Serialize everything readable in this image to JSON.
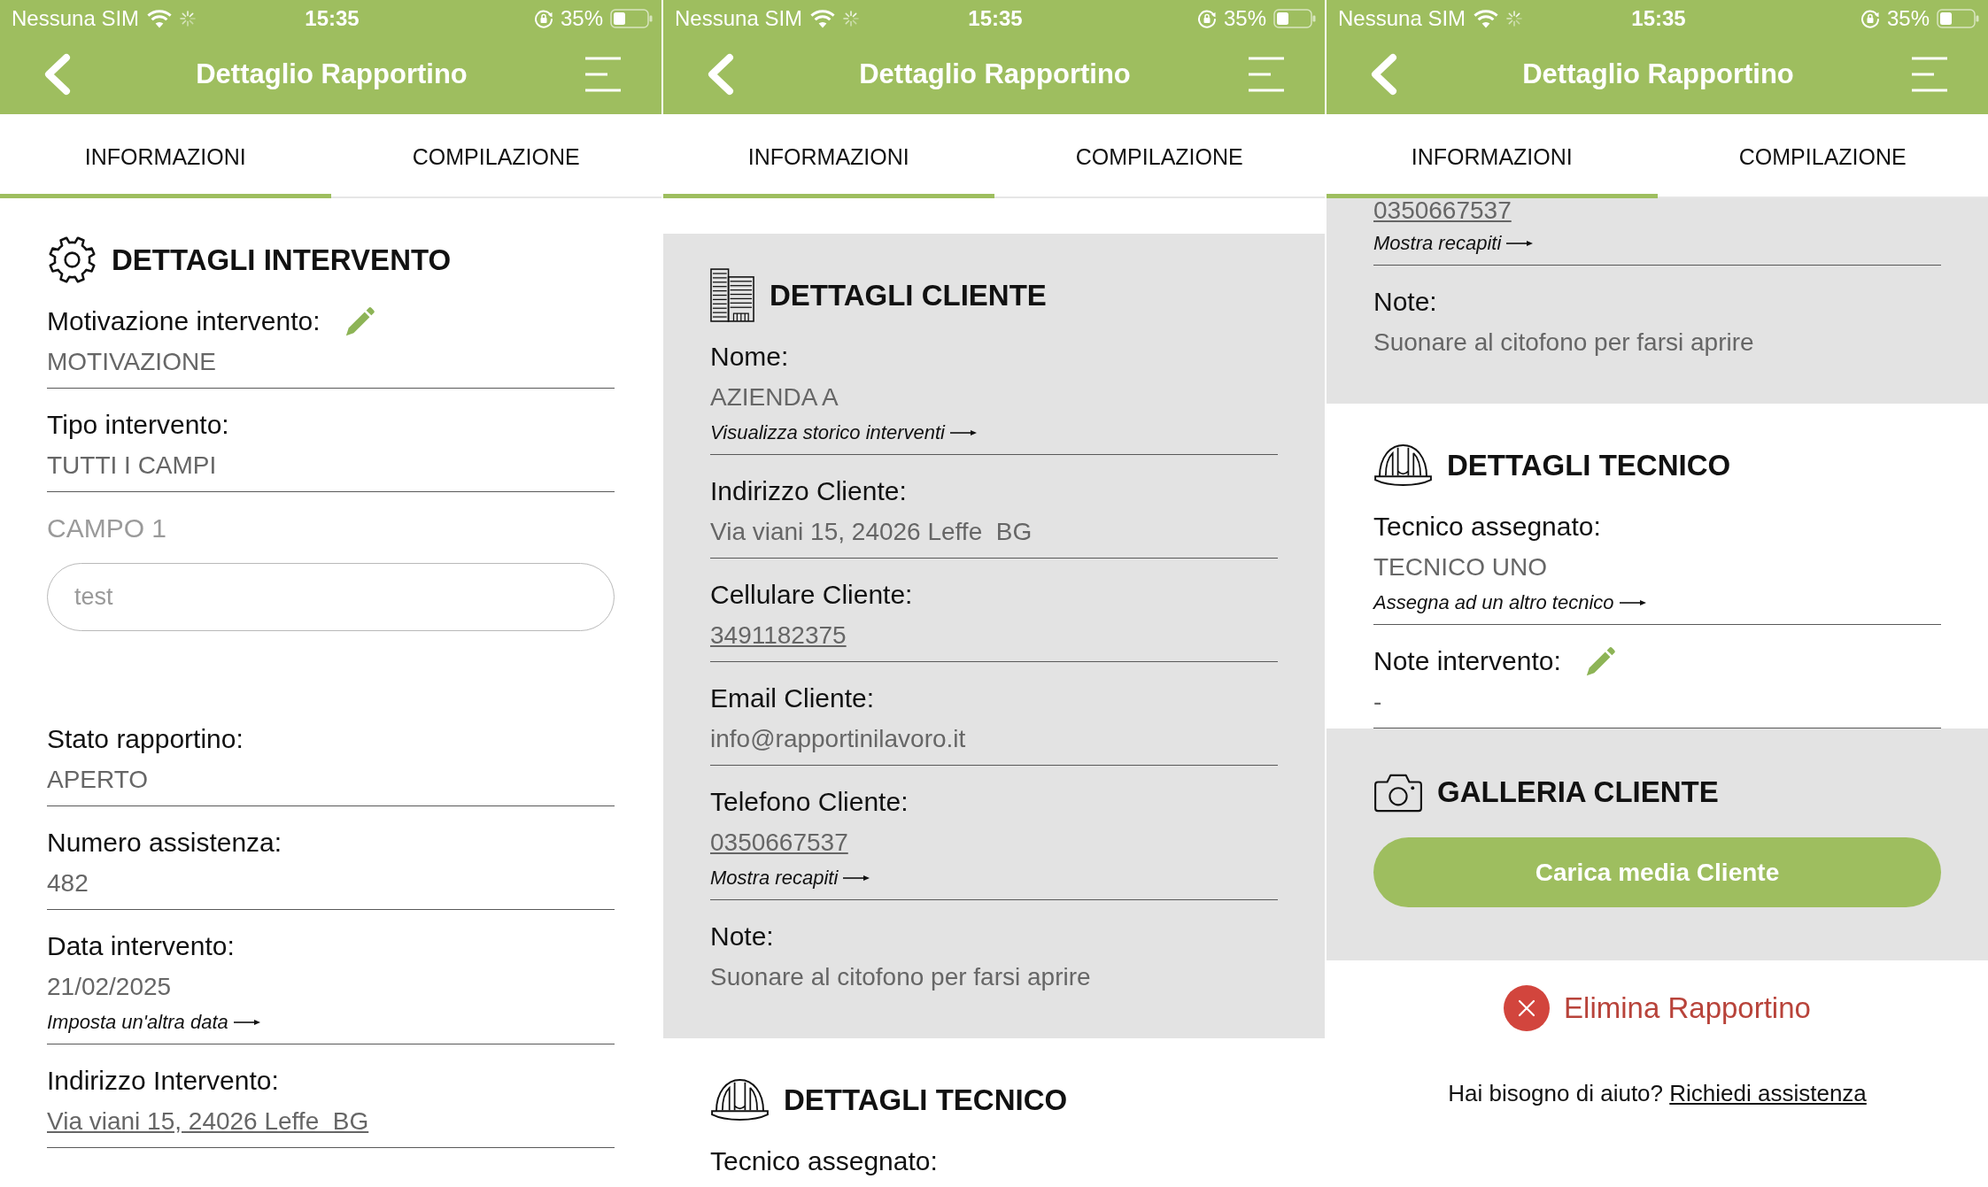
{
  "screens": [
    {
      "status_bar": {
        "carrier": "Nessuna SIM",
        "time": "15:35",
        "battery": "35%"
      },
      "header": {
        "title": "Dettaglio Rapportino"
      },
      "tabs": [
        {
          "label": "INFORMAZIONI",
          "selected": true
        },
        {
          "label": "COMPILAZIONE",
          "selected": false
        }
      ],
      "sections": [
        {
          "kind": "job",
          "shaded": false,
          "title": "DETTAGLI INTERVENTO",
          "fields": [
            {
              "kind": "text",
              "label": "Motivazione intervento:",
              "value": "MOTIVAZIONE",
              "editable": true
            },
            {
              "kind": "text",
              "label": "Tipo intervento:",
              "value": "TUTTI I CAMPI",
              "editable": false
            },
            {
              "kind": "input",
              "label": "CAMPO 1",
              "value": "test",
              "editable": false,
              "disabled": true
            },
            {
              "kind": "text",
              "label": "Stato rapportino:",
              "value": "APERTO",
              "editable": false
            },
            {
              "kind": "text",
              "label": "Numero assistenza:",
              "value": "482",
              "editable": false
            },
            {
              "kind": "text",
              "label": "Data intervento:",
              "value": "21/02/2025",
              "action": "Imposta un'altra data",
              "editable": false
            },
            {
              "kind": "link",
              "label": "Indirizzo Intervento:",
              "value": "Via viani 15, 24026 Leffe  BG",
              "editable": false
            }
          ]
        }
      ]
    },
    {
      "status_bar": {
        "carrier": "Nessuna SIM",
        "time": "15:35",
        "battery": "35%"
      },
      "header": {
        "title": "Dettaglio Rapportino"
      },
      "tabs": [
        {
          "label": "INFORMAZIONI",
          "selected": true
        },
        {
          "label": "COMPILAZIONE",
          "selected": false
        }
      ],
      "sections": [
        {
          "kind": "client",
          "shaded": true,
          "title": "DETTAGLI CLIENTE",
          "fields": [
            {
              "kind": "text",
              "label": "Nome:",
              "value": "AZIENDA A",
              "action": "Visualizza storico interventi",
              "editable": false
            },
            {
              "kind": "text",
              "label": "Indirizzo Cliente:",
              "value": "Via viani 15, 24026 Leffe  BG",
              "editable": false
            },
            {
              "kind": "link",
              "label": "Cellulare Cliente:",
              "value": "3491182375",
              "editable": false
            },
            {
              "kind": "text",
              "label": "Email Cliente:",
              "value": "info@rapportinilavoro.it",
              "editable": false
            },
            {
              "kind": "link",
              "label": "Telefono Cliente:",
              "value": "0350667537",
              "action": "Mostra recapiti",
              "editable": false
            },
            {
              "kind": "text",
              "label": "Note:",
              "value": "Suonare al citofono per farsi aprire",
              "editable": false
            }
          ]
        },
        {
          "kind": "technician",
          "shaded": false,
          "title": "DETTAGLI TECNICO",
          "fields": [
            {
              "kind": "text",
              "label": "Tecnico assegnato:",
              "editable": false
            }
          ]
        }
      ]
    },
    {
      "status_bar": {
        "carrier": "Nessuna SIM",
        "time": "15:35",
        "battery": "35%"
      },
      "header": {
        "title": "Dettaglio Rapportino"
      },
      "tabs": [
        {
          "label": "INFORMAZIONI",
          "selected": true
        },
        {
          "label": "COMPILAZIONE",
          "selected": false
        }
      ],
      "sections": [
        {
          "shaded": true,
          "fields": [
            {
              "kind": "link",
              "value": "0350667537",
              "action": "Mostra recapiti",
              "editable": false
            },
            {
              "kind": "text",
              "label": "Note:",
              "value": "Suonare al citofono per farsi aprire",
              "editable": false
            }
          ]
        },
        {
          "kind": "technician",
          "shaded": false,
          "title": "DETTAGLI TECNICO",
          "fields": [
            {
              "kind": "text",
              "label": "Tecnico assegnato:",
              "value": "TECNICO UNO",
              "action": "Assegna ad un altro tecnico",
              "editable": false
            },
            {
              "kind": "text",
              "label": "Note intervento:",
              "value": "-",
              "editable": true
            }
          ]
        },
        {
          "kind": "gallery",
          "shaded": true,
          "title": "GALLERIA CLIENTE",
          "button": "Carica media Cliente"
        }
      ],
      "footer": {
        "delete": "Elimina Rapportino",
        "help_text": "Hai bisogno di aiuto?",
        "help_link": "Richiedi assistenza"
      }
    }
  ]
}
